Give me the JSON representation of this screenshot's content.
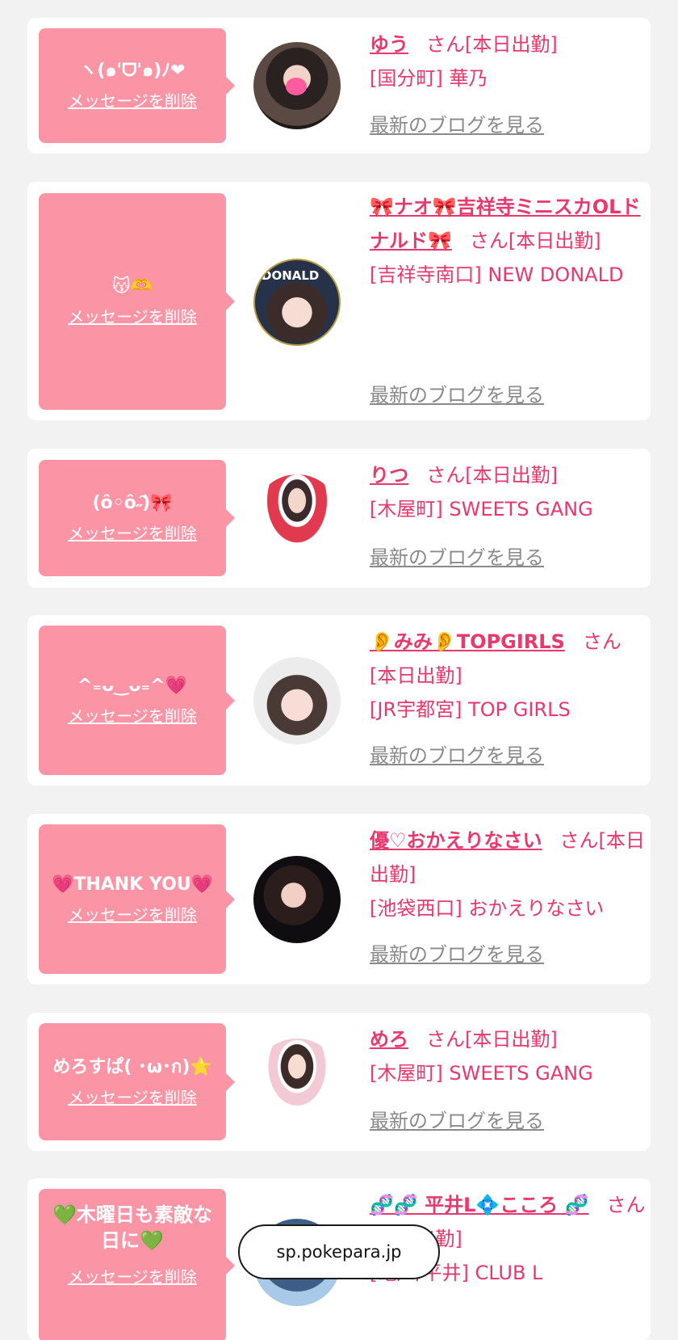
{
  "colors": {
    "accent": "#e8386e",
    "bubble": "#fb95a6",
    "muted": "#8a8a8a",
    "background": "#f2f2f2"
  },
  "cards": [
    {
      "message": "ヽ(๑'ᗜ'๑)ﾉ❤",
      "delete_label": "メッセージを削除",
      "name": "ゆう",
      "san": "さん",
      "status": "[本日出勤]",
      "shop": "[国分町] 華乃",
      "blog_label": "最新のブログを見る"
    },
    {
      "message": "😽🫶",
      "delete_label": "メッセージを削除",
      "name": "🎀ナオ🎀吉祥寺ミニスカOLドナルド🎀",
      "san": "さん",
      "status": "[本日出勤]",
      "shop": "[吉祥寺南口] NEW DONALD",
      "blog_label": "最新のブログを見る",
      "avatar_text": "DONALD"
    },
    {
      "message": "(ȏ◦ȏ˶̑)🎀",
      "delete_label": "メッセージを削除",
      "name": "りつ",
      "san": "さん",
      "status": "[本日出勤]",
      "shop": "[木屋町] SWEETS GANG",
      "blog_label": "最新のブログを見る"
    },
    {
      "message": "^₌ᴗ‿ᴗ₌^💗",
      "delete_label": "メッセージを削除",
      "name": "👂みみ👂TOPGIRLS",
      "san": "さん",
      "status": "[本日出勤]",
      "shop": "[JR宇都宮] TOP GIRLS",
      "blog_label": "最新のブログを見る"
    },
    {
      "message": "💗THANK YOU💗",
      "delete_label": "メッセージを削除",
      "name": "優♡おかえりなさい",
      "san": "さん",
      "status": "[本日出勤]",
      "shop": "[池袋西口] おかえりなさい",
      "blog_label": "最新のブログを見る"
    },
    {
      "message": "めろすぱ( ･ω･ก)⭐️",
      "delete_label": "メッセージを削除",
      "name": "めろ",
      "san": "さん",
      "status": "[本日出勤]",
      "shop": "[木屋町] SWEETS GANG",
      "blog_label": "最新のブログを見る"
    },
    {
      "message": "💚木曜日も素敵な日に💚",
      "delete_label": "メッセージを削除",
      "name": "🧬🧬 平井L💠こころ 🧬",
      "san": "さん",
      "status": "[本日出勤]",
      "shop": "[亀戸/平井] CLUB L",
      "blog_label": "最新のブログを見る"
    }
  ],
  "browser": {
    "url": "sp.pokepara.jp"
  }
}
